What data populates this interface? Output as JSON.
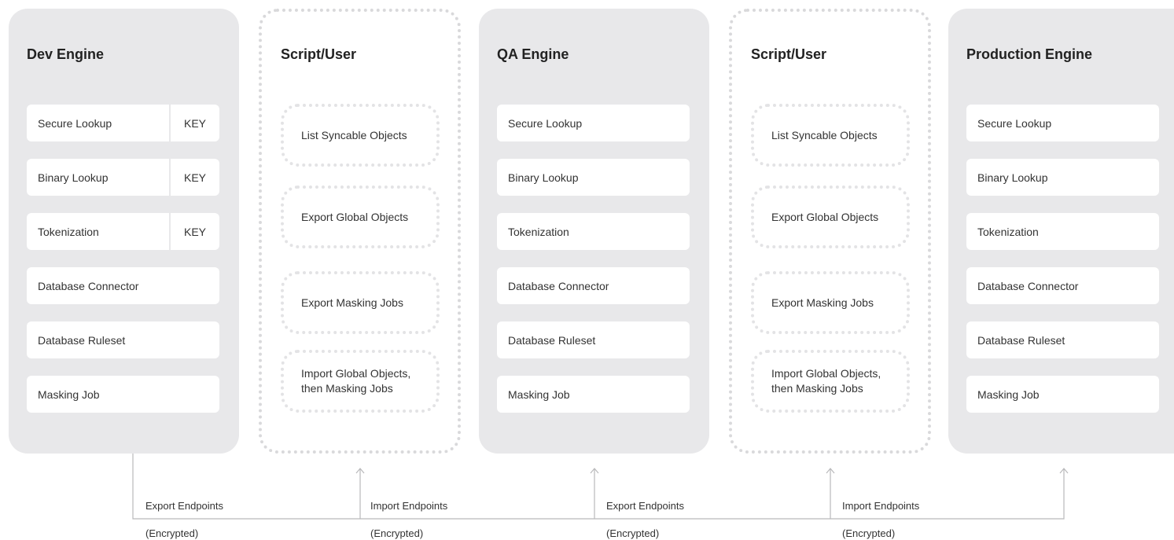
{
  "panels": [
    {
      "title": "Dev Engine",
      "items": [
        {
          "label": "Secure Lookup",
          "key": "KEY"
        },
        {
          "label": "Binary Lookup",
          "key": "KEY"
        },
        {
          "label": "Tokenization",
          "key": "KEY"
        },
        {
          "label": "Database Connector"
        },
        {
          "label": "Database Ruleset"
        },
        {
          "label": "Masking Job"
        }
      ]
    },
    {
      "title": "Script/User",
      "steps": [
        "List Syncable Objects",
        "Export Global Objects",
        "Export Masking Jobs",
        "Import Global Objects,\nthen Masking Jobs"
      ]
    },
    {
      "title": "QA Engine",
      "items": [
        {
          "label": "Secure Lookup"
        },
        {
          "label": "Binary Lookup"
        },
        {
          "label": "Tokenization"
        },
        {
          "label": "Database Connector"
        },
        {
          "label": "Database Ruleset"
        },
        {
          "label": "Masking Job"
        }
      ]
    },
    {
      "title": "Script/User",
      "steps": [
        "List Syncable Objects",
        "Export Global Objects",
        "Export Masking Jobs",
        "Import Global Objects,\nthen Masking Jobs"
      ]
    },
    {
      "title": "Production Engine",
      "items": [
        {
          "label": "Secure Lookup"
        },
        {
          "label": "Binary Lookup"
        },
        {
          "label": "Tokenization"
        },
        {
          "label": "Database Connector"
        },
        {
          "label": "Database Ruleset"
        },
        {
          "label": "Masking Job"
        }
      ]
    }
  ],
  "connectors": [
    {
      "label": "Export Endpoints",
      "note": "(Encrypted)"
    },
    {
      "label": "Import Endpoints",
      "note": "(Encrypted)"
    },
    {
      "label": "Export Endpoints",
      "note": "(Encrypted)"
    },
    {
      "label": "Import Endpoints",
      "note": "(Encrypted)"
    }
  ],
  "colors": {
    "engine_bg": "#e8e8ea",
    "dotted_border": "#d9d9db",
    "line": "#b9b9bb"
  }
}
